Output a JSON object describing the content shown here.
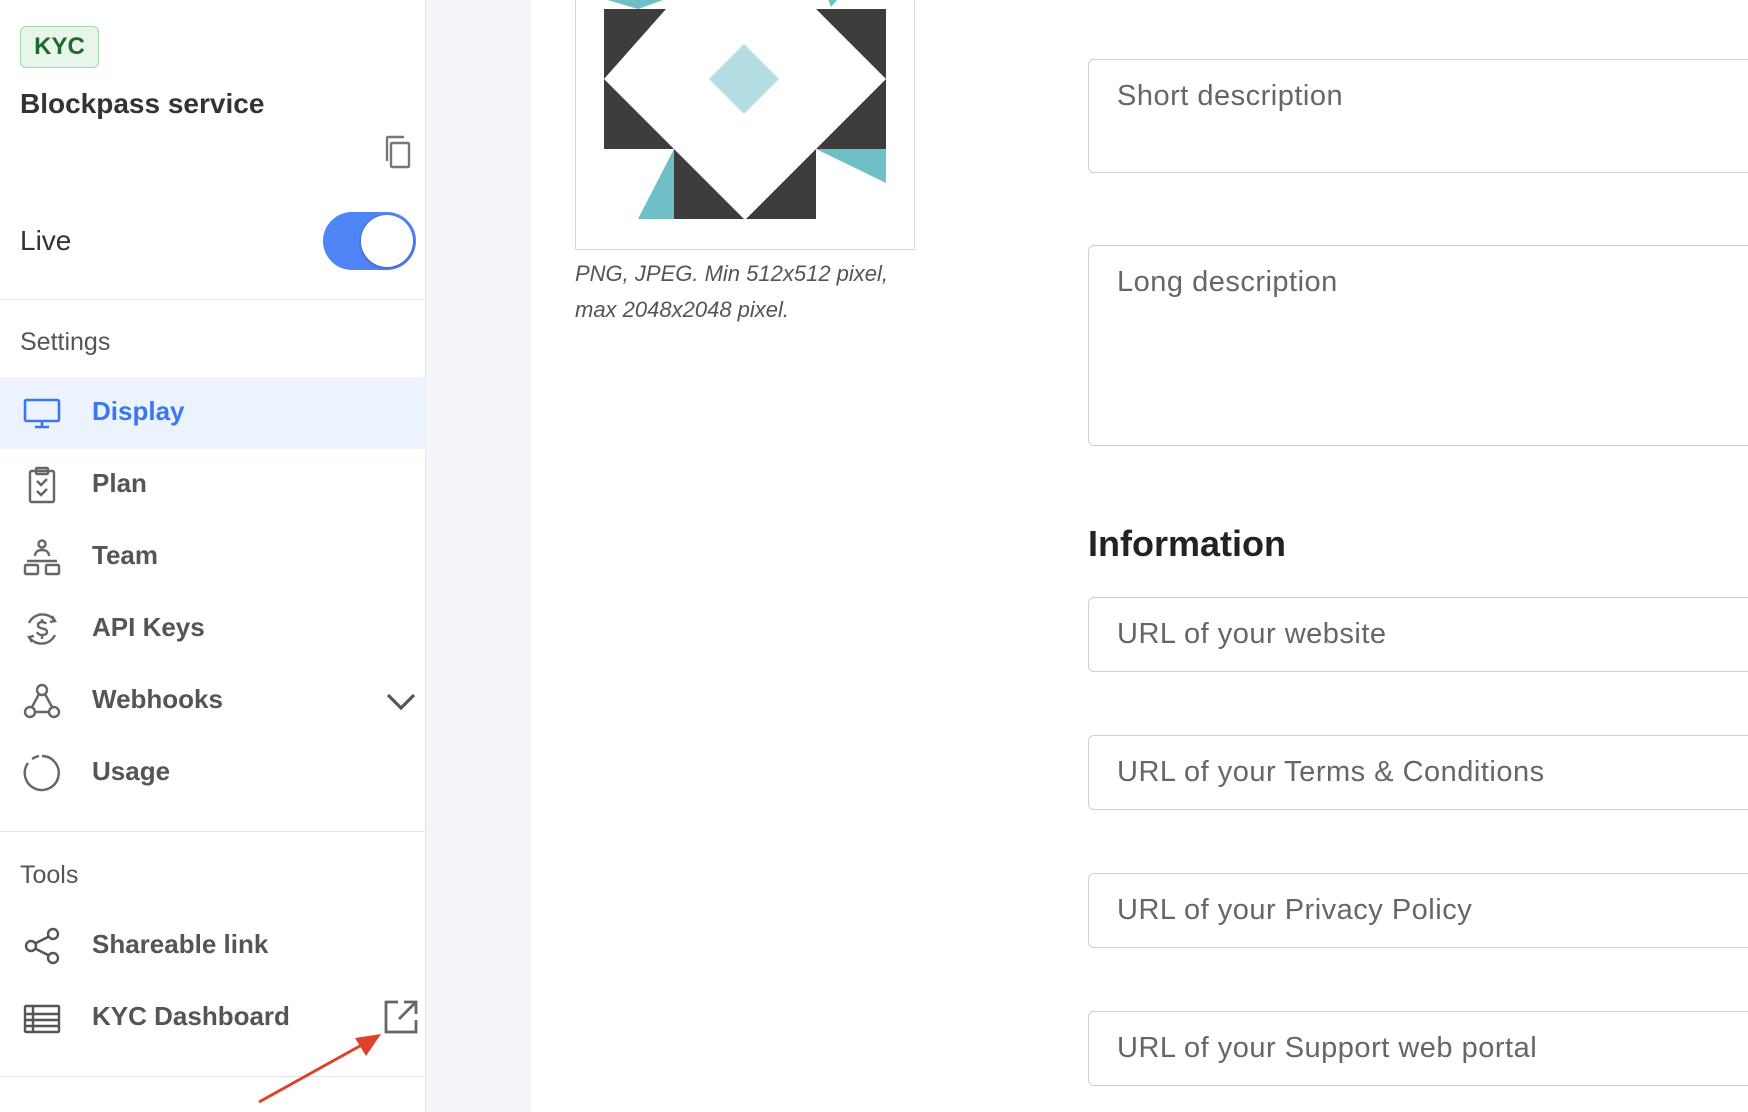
{
  "sidebar": {
    "badge": "KYC",
    "service_title": "Blockpass service",
    "live_label": "Live",
    "live_on": true,
    "settings_label": "Settings",
    "settings_items": [
      {
        "label": "Display",
        "icon": "monitor-icon",
        "active": true
      },
      {
        "label": "Plan",
        "icon": "clipboard-check-icon"
      },
      {
        "label": "Team",
        "icon": "team-hierarchy-icon"
      },
      {
        "label": "API Keys",
        "icon": "dollar-sync-icon"
      },
      {
        "label": "Webhooks",
        "icon": "webhook-icon",
        "expandable": true
      },
      {
        "label": "Usage",
        "icon": "usage-ring-icon"
      }
    ],
    "tools_label": "Tools",
    "tools_items": [
      {
        "label": "Shareable link",
        "icon": "share-icon"
      },
      {
        "label": "KYC Dashboard",
        "icon": "table-icon",
        "external": true
      }
    ]
  },
  "main": {
    "logo_note": "PNG, JPEG. Min 512x512 pixel, max 2048x2048 pixel.",
    "fields_top": {
      "short_description": "Short description",
      "long_description": "Long description"
    },
    "information_heading": "Information",
    "info_fields": {
      "website": "URL of your website",
      "terms": "URL of your Terms & Conditions",
      "privacy": "URL of your Privacy Policy",
      "support": "URL of your Support web portal"
    }
  },
  "colors": {
    "accent": "#3b78f0",
    "toggle": "#4f85f6",
    "badge_bg": "#e8f5e9",
    "badge_text": "#1b6b2c",
    "logo_dark": "#3d3d3d",
    "logo_teal": "#6fbfc6",
    "annotation_arrow": "#e0402a"
  }
}
